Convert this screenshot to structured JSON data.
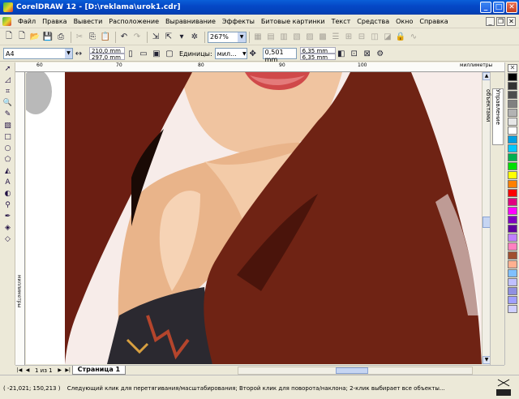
{
  "window": {
    "title": "CorelDRAW 12 - [D:\\reklama\\urok1.cdr]",
    "minimize": "_",
    "maximize": "□",
    "close": "✕"
  },
  "menu": [
    {
      "label": "Файл"
    },
    {
      "label": "Правка"
    },
    {
      "label": "Вывести"
    },
    {
      "label": "Расположение"
    },
    {
      "label": "Выравнивание"
    },
    {
      "label": "Эффекты"
    },
    {
      "label": "Битовые картинки"
    },
    {
      "label": "Текст"
    },
    {
      "label": "Средства"
    },
    {
      "label": "Окно"
    },
    {
      "label": "Справка"
    }
  ],
  "toolbar": {
    "zoom": "267%"
  },
  "property_bar": {
    "paper": "A4",
    "width": "210,0 mm",
    "height": "297,0 mm",
    "units_label": "Единицы:",
    "units_value": "мил...",
    "nudge": "0,501 mm",
    "dup_x": "6,35 mm",
    "dup_y": "6,35 mm"
  },
  "rulers": {
    "h_ticks": [
      "60",
      "70",
      "80",
      "90",
      "100"
    ],
    "unit": "миллиметры"
  },
  "docker": {
    "tab_label": "Управление объектами"
  },
  "palette": {
    "colors": [
      "#000000",
      "#333333",
      "#4d4d4d",
      "#808080",
      "#b3b3b3",
      "#e6e6e6",
      "#ffffff",
      "#00a0e0",
      "#00c8ff",
      "#00b050",
      "#00e000",
      "#ffff00",
      "#ff8000",
      "#ff0000",
      "#e00080",
      "#ff00ff",
      "#8000c0",
      "#6000a0",
      "#c080ff",
      "#ff80c0",
      "#a05030",
      "#ffb090",
      "#80c0ff",
      "#c0c0ff",
      "#9090e0",
      "#a0a0ff",
      "#d0d0ff"
    ]
  },
  "pages": {
    "count": "1 из 1",
    "tab": "Страница 1"
  },
  "status": {
    "coords": "( -21,021; 150,213 )",
    "hint": "Следующий клик для перетягивания/масштабирования; Второй клик для поворота/наклона; 2-клик выбирает все объекты..."
  }
}
